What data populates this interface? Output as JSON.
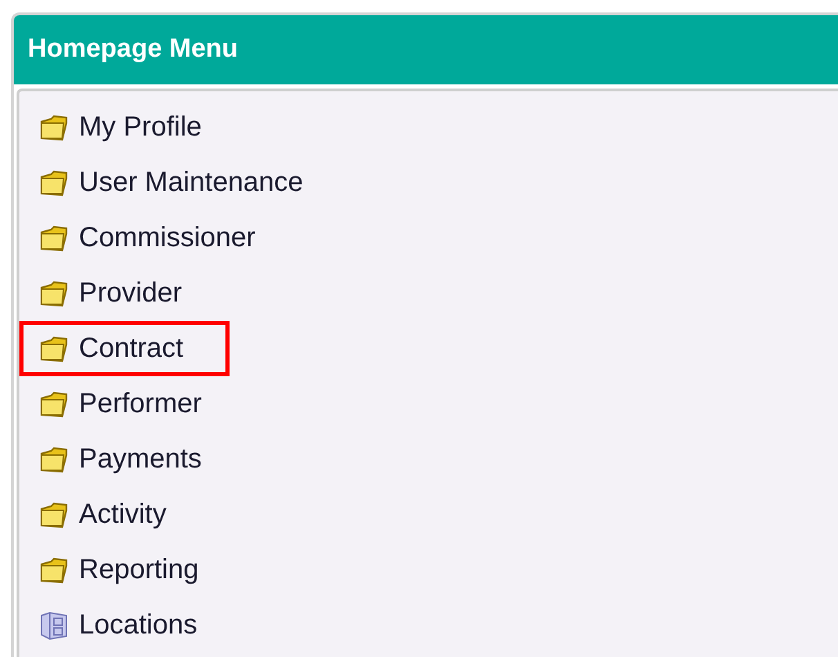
{
  "panel": {
    "title": "Homepage Menu"
  },
  "menu": {
    "items": [
      {
        "label": "My Profile",
        "kind": "folder",
        "highlighted": false
      },
      {
        "label": "User Maintenance",
        "kind": "folder",
        "highlighted": false
      },
      {
        "label": "Commissioner",
        "kind": "folder",
        "highlighted": false
      },
      {
        "label": "Provider",
        "kind": "folder",
        "highlighted": false
      },
      {
        "label": "Contract",
        "kind": "folder",
        "highlighted": true
      },
      {
        "label": "Performer",
        "kind": "folder",
        "highlighted": false
      },
      {
        "label": "Payments",
        "kind": "folder",
        "highlighted": false
      },
      {
        "label": "Activity",
        "kind": "folder",
        "highlighted": false
      },
      {
        "label": "Reporting",
        "kind": "folder",
        "highlighted": false
      },
      {
        "label": "Locations",
        "kind": "cabinet",
        "highlighted": false
      }
    ]
  }
}
